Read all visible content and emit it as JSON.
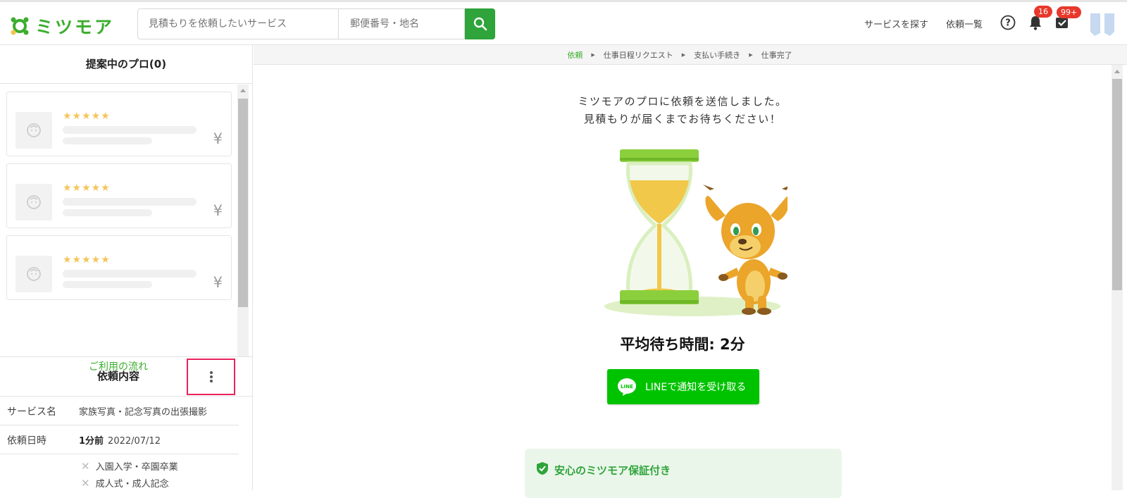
{
  "header": {
    "logo_text": "ミツモア",
    "search_placeholder": "見積もりを依頼したいサービス",
    "location_placeholder": "郵便番号・地名",
    "nav": {
      "find_service": "サービスを探す",
      "requests": "依頼一覧"
    },
    "notifications_badge": "16",
    "tasks_badge": "99+"
  },
  "sidebar": {
    "title": "提案中のプロ(0)",
    "cards": [
      {
        "stars": "★★★★★",
        "yen": "¥"
      },
      {
        "stars": "★★★★★",
        "yen": "¥"
      },
      {
        "stars": "★★★★★",
        "yen": "¥"
      }
    ],
    "flow_link": "ご利用の流れ",
    "request": {
      "title": "依頼内容",
      "service_label": "サービス名",
      "service_value": "家族写真・記念写真の出張撮影",
      "date_label": "依頼日時",
      "date_relative": "1分前",
      "date_value": "2022/07/12",
      "categories": [
        "入園入学・卒園卒業",
        "成人式・成人記念"
      ]
    }
  },
  "breadcrumb": [
    "依頼",
    "仕事日程リクエスト",
    "支払い手続き",
    "仕事完了"
  ],
  "main": {
    "message_line1": "ミツモアのプロに依頼を送信しました。",
    "message_line2": "見積もりが届くまでお待ちください！",
    "wait_time": "平均待ち時間: 2分",
    "line_button": "LINEで通知を受け取る",
    "line_icon_text": "LINE",
    "guarantee": "安心のミツモア保証付き"
  },
  "colors": {
    "brand": "#3cad2e",
    "line": "#00c300",
    "badge": "#e8382b",
    "highlight": "#e8235a"
  }
}
